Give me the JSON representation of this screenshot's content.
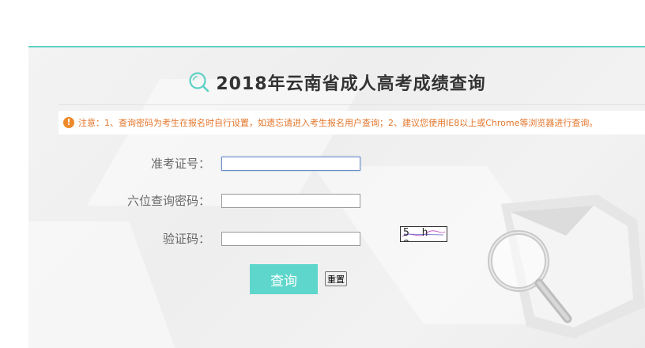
{
  "title": "2018年云南省成人高考成绩查询",
  "notice": {
    "icon": "exclamation-icon",
    "text": "注意：1、查询密码为考生在报名时自行设置，如遗忘请进入考生报名用户查询；2、建议您使用IE8以上或Chrome等浏览器进行查询。"
  },
  "form": {
    "exam_number_label": "准考证号：",
    "exam_number_value": "",
    "password_label": "六位查询密码：",
    "password_value": "",
    "captcha_label": "验证码：",
    "captcha_value": "",
    "captcha_image_text": "5 h 8 w"
  },
  "buttons": {
    "submit_label": "查询",
    "reset_label": "重置"
  },
  "colors": {
    "accent": "#5fd6cb",
    "notice": "#e4752a",
    "title": "#333333"
  }
}
